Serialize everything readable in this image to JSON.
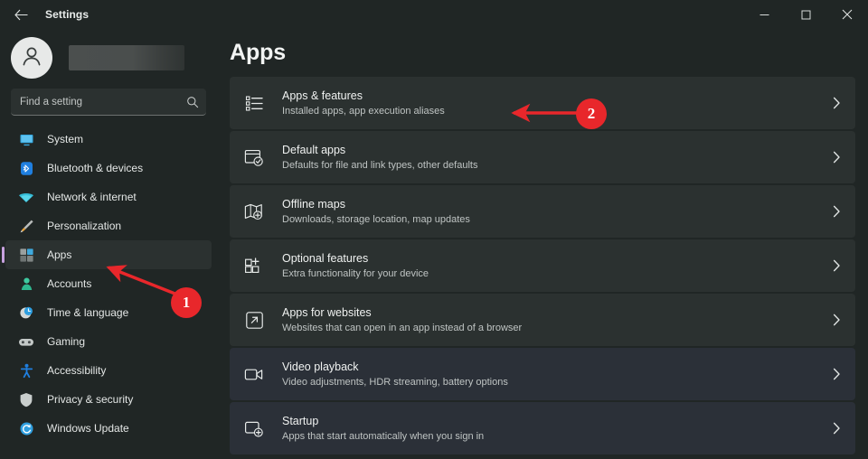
{
  "window": {
    "title": "Settings",
    "back_icon": "back-arrow-icon",
    "minimize_label": "Minimize",
    "maximize_label": "Maximize",
    "close_label": "Close"
  },
  "sidebar": {
    "account": {
      "avatar_icon": "user-avatar-icon",
      "name_redacted": ""
    },
    "search": {
      "placeholder": "Find a setting",
      "value": "",
      "icon": "search-icon"
    },
    "items": [
      {
        "label": "System",
        "icon": "monitor-icon",
        "selected": false
      },
      {
        "label": "Bluetooth & devices",
        "icon": "bluetooth-icon",
        "selected": false
      },
      {
        "label": "Network & internet",
        "icon": "wifi-icon",
        "selected": false
      },
      {
        "label": "Personalization",
        "icon": "paintbrush-icon",
        "selected": false
      },
      {
        "label": "Apps",
        "icon": "apps-grid-icon",
        "selected": true
      },
      {
        "label": "Accounts",
        "icon": "person-icon",
        "selected": false
      },
      {
        "label": "Time & language",
        "icon": "clock-icon",
        "selected": false
      },
      {
        "label": "Gaming",
        "icon": "gamepad-icon",
        "selected": false
      },
      {
        "label": "Accessibility",
        "icon": "accessibility-icon",
        "selected": false
      },
      {
        "label": "Privacy & security",
        "icon": "shield-icon",
        "selected": false
      },
      {
        "label": "Windows Update",
        "icon": "update-icon",
        "selected": false
      }
    ]
  },
  "main": {
    "page_title": "Apps",
    "cards": [
      {
        "title": "Apps & features",
        "subtitle": "Installed apps, app execution aliases",
        "icon": "list-icon",
        "chevron": "chevron-right-icon"
      },
      {
        "title": "Default apps",
        "subtitle": "Defaults for file and link types, other defaults",
        "icon": "default-apps-icon",
        "chevron": "chevron-right-icon"
      },
      {
        "title": "Offline maps",
        "subtitle": "Downloads, storage location, map updates",
        "icon": "map-icon",
        "chevron": "chevron-right-icon"
      },
      {
        "title": "Optional features",
        "subtitle": "Extra functionality for your device",
        "icon": "optional-features-icon",
        "chevron": "chevron-right-icon"
      },
      {
        "title": "Apps for websites",
        "subtitle": "Websites that can open in an app instead of a browser",
        "icon": "external-link-icon",
        "chevron": "chevron-right-icon"
      },
      {
        "title": "Video playback",
        "subtitle": "Video adjustments, HDR streaming, battery options",
        "icon": "video-camera-icon",
        "chevron": "chevron-right-icon"
      },
      {
        "title": "Startup",
        "subtitle": "Apps that start automatically when you sign in",
        "icon": "startup-icon",
        "chevron": "chevron-right-icon"
      }
    ]
  },
  "annotations": {
    "color": "#e8272b",
    "markers": [
      {
        "label": "1",
        "points_to": "sidebar-item-apps"
      },
      {
        "label": "2",
        "points_to": "card-apps-and-features"
      }
    ]
  },
  "colors": {
    "page_background": "#202625",
    "card_background": "#2b3130",
    "accent_selection": "#c8a2e0",
    "annotation_red": "#e8272b"
  }
}
